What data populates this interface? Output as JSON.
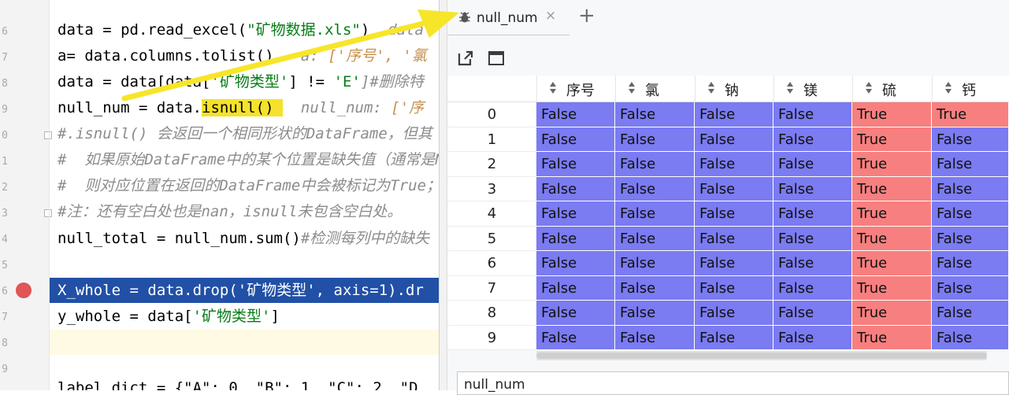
{
  "editor": {
    "line_numbers": [
      "6",
      "7",
      "8",
      "9",
      "0",
      "1",
      "2",
      "3",
      "4",
      "5",
      "",
      "6",
      "7",
      "8",
      "9",
      ""
    ],
    "lines": [
      {
        "code": "data = pd.read_excel(",
        "str": "\"矿物数据.xls\"",
        "tail": ")",
        "hint": "  data"
      },
      {
        "code": "a= data.columns.tolist()",
        "hint_label": "   a: ",
        "hint_str": "['序号', '氯"
      },
      {
        "code_a": "data = data[data[",
        "str": "'矿物类型'",
        "code_b": "] != ",
        "str2": "'E'",
        "comment": "]#删除特"
      },
      {
        "code_a": "null_num = data.",
        "hl": "isnull()",
        "hl_tail": " ",
        "hint_label": "  null_num: ",
        "hint_str": "['序"
      },
      {
        "comment": "#.isnull() 会返回一个相同形状的DataFrame，但其"
      },
      {
        "comment": "#  如果原始DataFrame中的某个位置是缺失值（通常是N"
      },
      {
        "comment": "#  则对应位置在返回的DataFrame中会被标记为True；"
      },
      {
        "comment": "#注：还有空白处也是nan，isnull未包含空白处。"
      },
      {
        "code": "null_total = null_num.sum()",
        "comment": "#检测每列中的缺失"
      },
      {
        "code": ""
      },
      {
        "code": "X_whole = data.drop('矿物类型', axis=1).dr"
      },
      {
        "code": "y_whole = data[",
        "str": "'矿物类型'",
        "tail": "]"
      },
      {
        "code": ""
      }
    ],
    "bottom_partial": "label_dict = {\"A\": 0, \"B\": 1, \"C\": 2, \"D"
  },
  "viewer": {
    "tab_title": "null_num",
    "close_glyph": "×",
    "add_glyph": "+",
    "columns": [
      "序号",
      "氯",
      "钠",
      "镁",
      "硫",
      "钙"
    ],
    "rows": [
      {
        "idx": "0",
        "vals": [
          "False",
          "False",
          "False",
          "False",
          "True",
          "True"
        ]
      },
      {
        "idx": "1",
        "vals": [
          "False",
          "False",
          "False",
          "False",
          "True",
          "False"
        ]
      },
      {
        "idx": "2",
        "vals": [
          "False",
          "False",
          "False",
          "False",
          "True",
          "False"
        ]
      },
      {
        "idx": "3",
        "vals": [
          "False",
          "False",
          "False",
          "False",
          "True",
          "False"
        ]
      },
      {
        "idx": "4",
        "vals": [
          "False",
          "False",
          "False",
          "False",
          "True",
          "False"
        ]
      },
      {
        "idx": "5",
        "vals": [
          "False",
          "False",
          "False",
          "False",
          "True",
          "False"
        ]
      },
      {
        "idx": "6",
        "vals": [
          "False",
          "False",
          "False",
          "False",
          "True",
          "False"
        ]
      },
      {
        "idx": "7",
        "vals": [
          "False",
          "False",
          "False",
          "False",
          "True",
          "False"
        ]
      },
      {
        "idx": "8",
        "vals": [
          "False",
          "False",
          "False",
          "False",
          "True",
          "False"
        ]
      },
      {
        "idx": "9",
        "vals": [
          "False",
          "False",
          "False",
          "False",
          "True",
          "False"
        ]
      }
    ],
    "console_text": "null_num"
  },
  "colors": {
    "false_cell": "#7b7bf2",
    "true_cell": "#f87f7f",
    "selection": "#2150a6",
    "highlight": "#f5e22a",
    "breakpoint": "#e05555",
    "string": "#067d17"
  },
  "icons": [
    "bug-icon",
    "close-icon",
    "add-tab-icon",
    "open-external-icon",
    "maximize-icon",
    "breakpoint-icon",
    "fold-icon"
  ]
}
